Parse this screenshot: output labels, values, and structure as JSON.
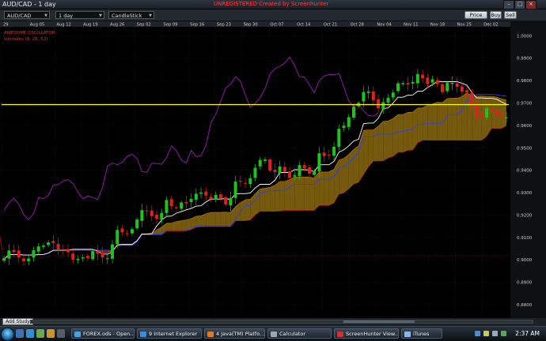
{
  "window": {
    "title": "AUD/CAD - 1 day",
    "recorder_text": "UNREGISTERED  Created by Screenhunter"
  },
  "toolbar": {
    "symbol": "AUD/CAD",
    "period": "1 day",
    "chart_style": "CandleStick",
    "price_box_label": "Price Box",
    "buy_label": "Buy",
    "sell_label": "Sell"
  },
  "indicators": {
    "indicator_1": "AWESOME OSCILLATOR",
    "indicator_2": "Ichimoku (9, 26, 52)"
  },
  "footer": {
    "add_study_label": "Add Study"
  },
  "taskbar": {
    "items": [
      {
        "label": "FOREX.ods - Open...",
        "icon": "document-icon",
        "color": "#4aa0e0"
      },
      {
        "label": "9 Internet Explorer",
        "icon": "ie-icon",
        "color": "#3c8ad8"
      },
      {
        "label": "4 Java(TM) Platfo...",
        "icon": "java-icon",
        "color": "#e07a2b"
      },
      {
        "label": "Calculator",
        "icon": "calculator-icon",
        "color": "#9aa7b3"
      },
      {
        "label": "ScreenHunter View...",
        "icon": "camera-icon",
        "color": "#c33"
      },
      {
        "label": "iTunes",
        "icon": "itunes-icon",
        "color": "#8fb4e8"
      }
    ],
    "clock": "2:37 AM"
  },
  "chart_data": {
    "type": "candlestick",
    "title": "AUD/CAD - 1 day",
    "x_tick_labels": [
      "29",
      "Aug 05",
      "Aug 12",
      "Aug 19",
      "Aug 26",
      "Sep 02",
      "Sep 09",
      "Sep 16",
      "Sep 23",
      "Sep 30",
      "Oct 07",
      "Oct 14",
      "Oct 21",
      "Oct 28",
      "Nov 04",
      "Nov 11",
      "Nov 18",
      "Nov 25",
      "Dec 02"
    ],
    "y_tick_labels": [
      "1.0000",
      "0.9900",
      "0.9800",
      "0.9700",
      "0.9600",
      "0.9500",
      "0.9400",
      "0.9300",
      "0.9200",
      "0.9100",
      "0.9000",
      "0.8900",
      "0.8800"
    ],
    "ylim": [
      0.874,
      1.004
    ],
    "horizontal_line": 0.9693,
    "dotted_line": 0.9018,
    "colors": {
      "up": "#1fc21f",
      "down": "#e02020",
      "cloud_bull": "#8a6a10",
      "cloud_bear": "#a01010",
      "tenkan": "#ffffff",
      "kijun": "#2a3cff",
      "chikou": "#9d1ab5",
      "hline": "#ffff00",
      "dotted": "#c0c0c0"
    },
    "closes": [
      0.9008,
      0.9042,
      0.9036,
      0.901,
      0.8994,
      0.9006,
      0.9043,
      0.906,
      0.9064,
      0.9078,
      0.9075,
      0.9047,
      0.9044,
      0.9034,
      0.9001,
      0.9004,
      0.9011,
      0.9007,
      0.9039,
      0.9027,
      0.9011,
      0.9007,
      0.9069,
      0.9134,
      0.9123,
      0.9118,
      0.9137,
      0.918,
      0.9222,
      0.9218,
      0.9195,
      0.9183,
      0.9209,
      0.9267,
      0.924,
      0.923,
      0.9256,
      0.9252,
      0.9272,
      0.9295,
      0.9301,
      0.9287,
      0.9273,
      0.929,
      0.9274,
      0.9247,
      0.9276,
      0.9349,
      0.9349,
      0.9341,
      0.9364,
      0.9411,
      0.9446,
      0.9448,
      0.9398,
      0.9392,
      0.9417,
      0.9393,
      0.9366,
      0.9378,
      0.9423,
      0.9409,
      0.9385,
      0.9397,
      0.9476,
      0.9463,
      0.9469,
      0.9505,
      0.9585,
      0.9599,
      0.9637,
      0.9683,
      0.9701,
      0.9749,
      0.9751,
      0.9713,
      0.9677,
      0.9704,
      0.9723,
      0.9747,
      0.9788,
      0.9789,
      0.9783,
      0.9794,
      0.9829,
      0.9811,
      0.9785,
      0.9806,
      0.9784,
      0.9749,
      0.9791,
      0.979,
      0.9772,
      0.9751,
      0.9748,
      0.9691,
      0.9644,
      0.9641,
      0.9676,
      0.9664,
      0.9649,
      0.9639,
      0.9636
    ]
  }
}
